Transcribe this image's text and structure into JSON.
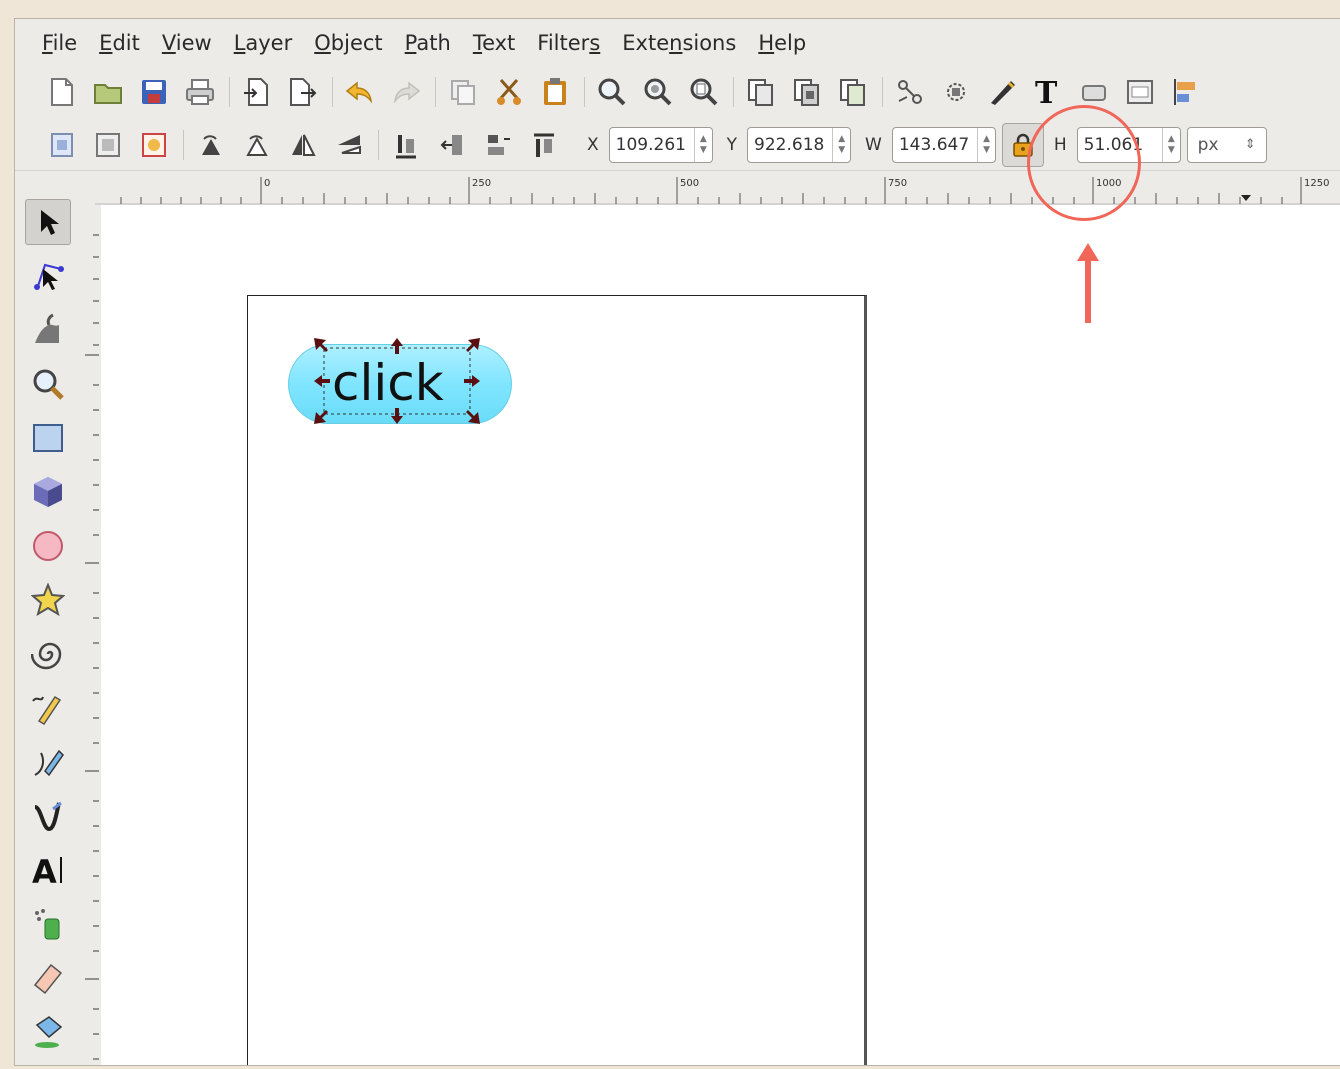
{
  "menu": {
    "items": [
      {
        "label": "File",
        "u": "F"
      },
      {
        "label": "Edit",
        "u": "E"
      },
      {
        "label": "View",
        "u": "V"
      },
      {
        "label": "Layer",
        "u": "L"
      },
      {
        "label": "Object",
        "u": "O"
      },
      {
        "label": "Path",
        "u": "P"
      },
      {
        "label": "Text",
        "u": "T"
      },
      {
        "label": "Filters",
        "u": "s"
      },
      {
        "label": "Extensions",
        "u": "n"
      },
      {
        "label": "Help",
        "u": "H"
      }
    ]
  },
  "select_toolbar": {
    "x_label": "X",
    "x_value": "109.261",
    "y_label": "Y",
    "y_value": "922.618",
    "w_label": "W",
    "w_value": "143.647",
    "h_label": "H",
    "h_value": "51.061",
    "unit": "px",
    "lock_icon": "lock-icon"
  },
  "ruler": {
    "labels": [
      "0",
      "250",
      "500",
      "750",
      "1000",
      "1250"
    ]
  },
  "canvas": {
    "button_text": "click"
  },
  "colors": {
    "accent": "#f0675a",
    "pill": "#80e5ff"
  }
}
